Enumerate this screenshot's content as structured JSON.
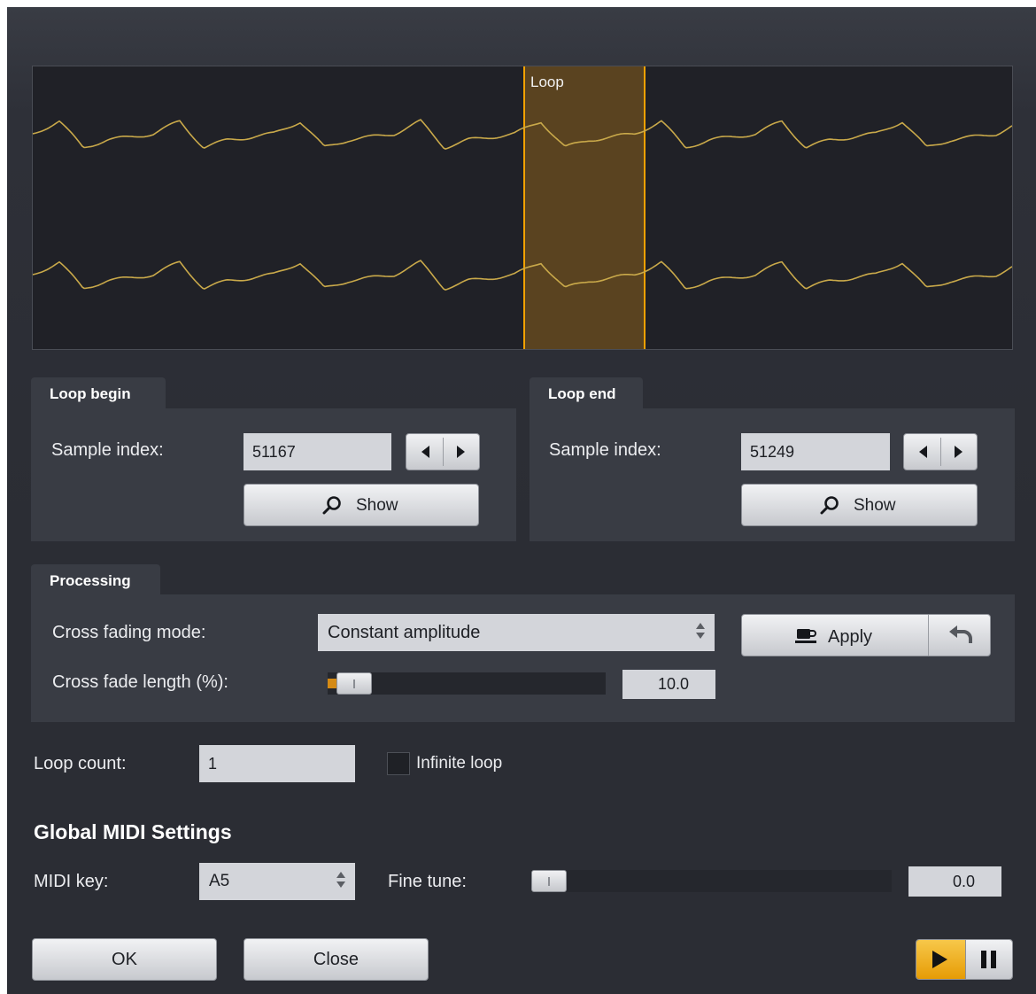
{
  "waveform": {
    "loop_label": "Loop"
  },
  "loop_begin": {
    "tab_label": "Loop begin",
    "sample_index_label": "Sample index:",
    "sample_index_value": "51167",
    "show_label": "Show"
  },
  "loop_end": {
    "tab_label": "Loop end",
    "sample_index_label": "Sample index:",
    "sample_index_value": "51249",
    "show_label": "Show"
  },
  "processing": {
    "tab_label": "Processing",
    "cross_fading_mode_label": "Cross fading mode:",
    "cross_fading_mode_value": "Constant amplitude",
    "apply_label": "Apply",
    "cross_fade_length_label": "Cross fade length (%):",
    "cross_fade_length_value": "10.0"
  },
  "loop_count": {
    "label": "Loop count:",
    "value": "1",
    "infinite_loop_label": "Infinite loop",
    "infinite_loop_checked": false
  },
  "midi": {
    "heading": "Global MIDI Settings",
    "key_label": "MIDI key:",
    "key_value": "A5",
    "fine_tune_label": "Fine tune:",
    "fine_tune_value": "0.0"
  },
  "footer": {
    "ok_label": "OK",
    "close_label": "Close"
  },
  "icons": {
    "show": "magnifier-icon",
    "apply": "cup-icon",
    "revert": "undo-icon",
    "play": "play-icon",
    "pause": "pause-icon"
  },
  "colors": {
    "accent": "#f0a800",
    "waveform": "#c9a94a",
    "loop_region": "#5a4320",
    "loop_marker": "#f2a100"
  }
}
